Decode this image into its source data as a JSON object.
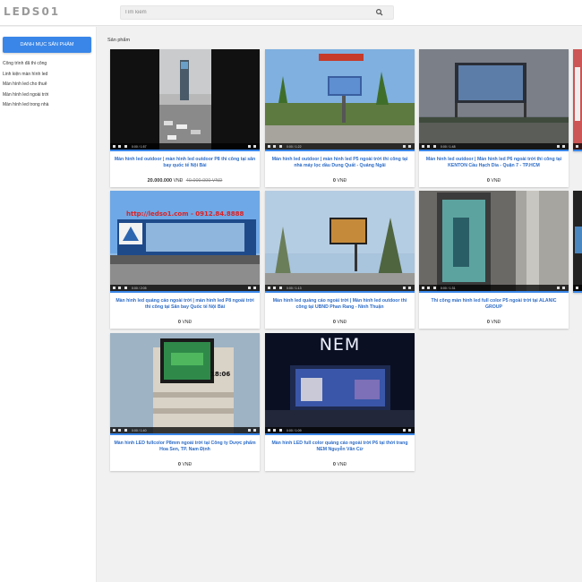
{
  "header": {
    "logo": "LEDS01",
    "search_placeholder": "Tìm kiếm"
  },
  "sidebar": {
    "category_button": "Danh mục sản phẩm",
    "items": [
      "Công trình đã thi công",
      "Linh kiện màn hình led",
      "Màn hình led cho thuê",
      "Màn hình led ngoài trời",
      "Màn hình led trong nhà"
    ]
  },
  "main": {
    "section_title": "Sản phẩm",
    "products": [
      {
        "title": "Màn hình led outdoor | màn hình led outdoor P8 thi công tại sân bay quốc tế Nội Bài",
        "price": "20.000.000",
        "currency": "VNĐ",
        "old_price": "40.000.000 VNĐ",
        "video_time": "0:00 / 1:57"
      },
      {
        "title": "Màn hình led outdoor | màn hình led P5 ngoài trời thi công tại nhà máy lọc dầu Dung Quất - Quảng Ngãi",
        "price": "0",
        "currency": "VNĐ",
        "video_time": "0:00 / 1:22"
      },
      {
        "title": "Màn hình led outdoor | Màn hình led P6 ngoài trời thi công tại KENTON Cầu Hạch Dia - Quận 7 - TP.HCM",
        "price": "0",
        "currency": "VNĐ",
        "video_time": "0:00 / 1:48"
      },
      {
        "title": "Màn hình led quảng cáo ngoài trời | màn hình led P8 ngoài trời thi công tại Sân bay Quốc tế Nội Bài",
        "price": "0",
        "currency": "VNĐ",
        "video_time": "0:00 / 2:05",
        "banner": "http://ledso1.com - 0912.84.8888"
      },
      {
        "title": "Màn hình led quảng cáo ngoài trời | Màn hình led outdoor thi công tại UBND Phan Rang - Ninh Thuận",
        "price": "0",
        "currency": "VNĐ",
        "video_time": "0:00 / 1:13"
      },
      {
        "title": "Thi công màn hình led full color P5 ngoài trời tại ALANIC GROUP",
        "price": "0",
        "currency": "VNĐ",
        "video_time": "0:00 / 1:31"
      },
      {
        "title": "Màn hình LED fullcolor P8mm ngoài trời tại Công ty Dược phẩm Hoa Sen, TP. Nam Định",
        "price": "0",
        "currency": "VNĐ",
        "video_time": "0:00 / 1:40",
        "screen_text": "18:06"
      },
      {
        "title": "Màn hình LED full color quảng cáo ngoài trời P6 tại thời trang NEM Nguyễn Văn Cừ",
        "price": "0",
        "currency": "VNĐ",
        "video_time": "0:00 / 1:09",
        "sign_text": "NEM"
      }
    ]
  },
  "colors": {
    "accent": "#3a86e8",
    "title_blue": "#2d6cc7",
    "page_bg": "#f1f1f1"
  }
}
